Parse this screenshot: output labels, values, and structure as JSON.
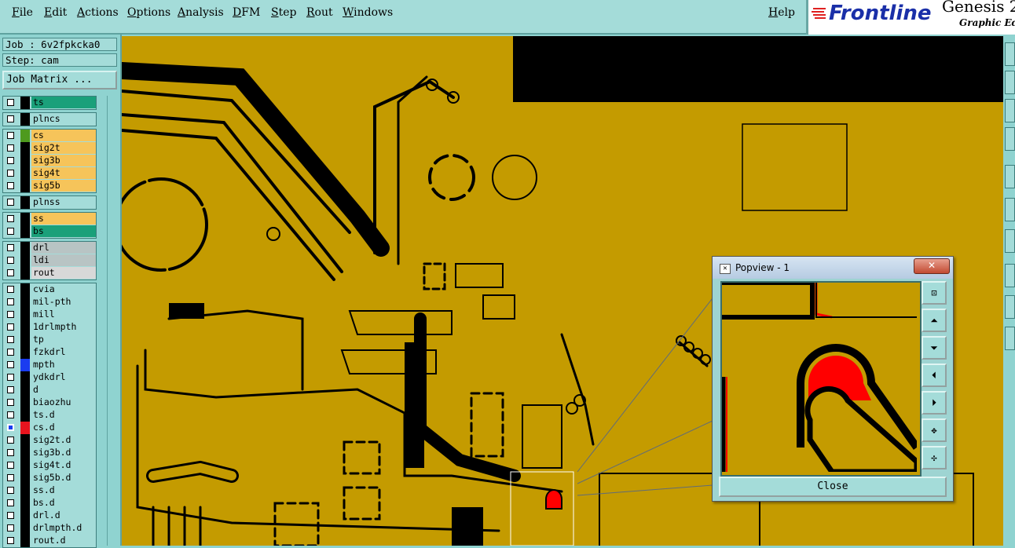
{
  "menu": [
    "File",
    "Edit",
    "Actions",
    "Options",
    "Analysis",
    "DFM",
    "Step",
    "Rout",
    "Windows"
  ],
  "help": "Help",
  "brand": {
    "logo": "Frontline",
    "product": "Genesis 2",
    "subtitle": "Graphic Edi"
  },
  "job": "Job : 6v2fpkcka0",
  "step": "Step: cam",
  "job_matrix": "Job Matrix ...",
  "layer_groups": [
    [
      {
        "name": "ts",
        "color": "#1aa07a",
        "swatch": "#000"
      }
    ],
    [
      {
        "name": "plncs",
        "color": "#a4dcd9",
        "swatch": "#000"
      }
    ],
    [
      {
        "name": "cs",
        "color": "#f6c45a",
        "swatch": "#4e9a1e"
      },
      {
        "name": "sig2t",
        "color": "#f6c45a",
        "swatch": "#000"
      },
      {
        "name": "sig3b",
        "color": "#f6c45a",
        "swatch": "#000"
      },
      {
        "name": "sig4t",
        "color": "#f6c45a",
        "swatch": "#000"
      },
      {
        "name": "sig5b",
        "color": "#f6c45a",
        "swatch": "#000"
      }
    ],
    [
      {
        "name": "plnss",
        "color": "#a4dcd9",
        "swatch": "#000"
      }
    ],
    [
      {
        "name": "ss",
        "color": "#f6c45a",
        "swatch": "#000"
      },
      {
        "name": "bs",
        "color": "#1aa07a",
        "swatch": "#000"
      }
    ],
    [
      {
        "name": "drl",
        "color": "#b8c4c4",
        "swatch": "#000"
      },
      {
        "name": "ldi",
        "color": "#b8c4c4",
        "swatch": "#000"
      },
      {
        "name": "rout",
        "color": "#d8d8d8",
        "swatch": "#000"
      }
    ],
    [
      {
        "name": "cvia",
        "color": "#a4dcd9",
        "swatch": "#000"
      },
      {
        "name": "mil-pth",
        "color": "#a4dcd9",
        "swatch": "#000"
      },
      {
        "name": "mill",
        "color": "#a4dcd9",
        "swatch": "#000"
      },
      {
        "name": "1drlmpth",
        "color": "#a4dcd9",
        "swatch": "#000"
      },
      {
        "name": "tp",
        "color": "#a4dcd9",
        "swatch": "#000"
      },
      {
        "name": "fzkdrl",
        "color": "#a4dcd9",
        "swatch": "#000"
      },
      {
        "name": "mpth",
        "color": "#a4dcd9",
        "swatch": "#1a3cf0"
      },
      {
        "name": "ydkdrl",
        "color": "#a4dcd9",
        "swatch": "#000"
      },
      {
        "name": "d",
        "color": "#a4dcd9",
        "swatch": "#000"
      },
      {
        "name": "biaozhu",
        "color": "#a4dcd9",
        "swatch": "#000"
      },
      {
        "name": "ts.d",
        "color": "#a4dcd9",
        "swatch": "#000"
      },
      {
        "name": "cs.d",
        "color": "#a4dcd9",
        "swatch": "#e8141e",
        "active": true
      },
      {
        "name": "sig2t.d",
        "color": "#a4dcd9",
        "swatch": "#000"
      },
      {
        "name": "sig3b.d",
        "color": "#a4dcd9",
        "swatch": "#000"
      },
      {
        "name": "sig4t.d",
        "color": "#a4dcd9",
        "swatch": "#000"
      },
      {
        "name": "sig5b.d",
        "color": "#a4dcd9",
        "swatch": "#000"
      },
      {
        "name": "ss.d",
        "color": "#a4dcd9",
        "swatch": "#000"
      },
      {
        "name": "bs.d",
        "color": "#a4dcd9",
        "swatch": "#000"
      },
      {
        "name": "drl.d",
        "color": "#a4dcd9",
        "swatch": "#000"
      },
      {
        "name": "drlmpth.d",
        "color": "#a4dcd9",
        "swatch": "#000"
      },
      {
        "name": "rout.d",
        "color": "#a4dcd9",
        "swatch": "#000"
      }
    ]
  ],
  "popview": {
    "title": "Popview - 1",
    "close_x": "✕",
    "close_label": "Close"
  },
  "colors": {
    "board": "#c49b00",
    "copper": "#000000",
    "highlight": "#ff0000"
  }
}
